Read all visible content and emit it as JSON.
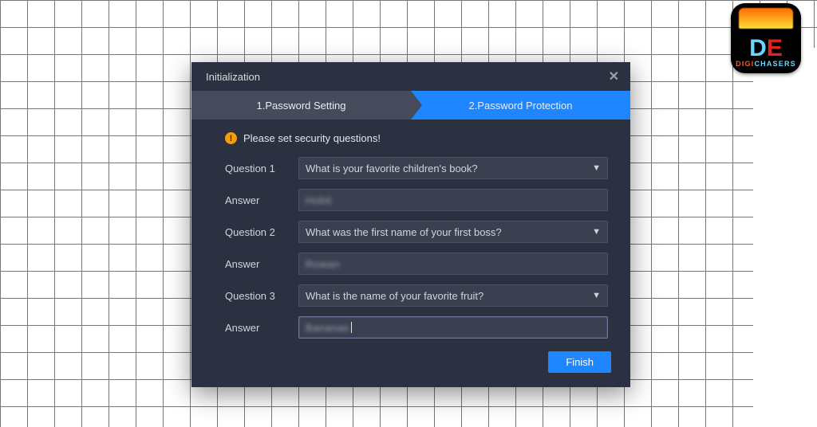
{
  "logo": {
    "brand_top": "DE",
    "brand_bottom_a": "DIGI",
    "brand_bottom_b": "CHASERS"
  },
  "dialog": {
    "title": "Initialization",
    "steps": {
      "one": "1.Password Setting",
      "two": "2.Password Protection"
    },
    "alert": {
      "icon": "!",
      "text": "Please set security questions!"
    },
    "rows": [
      {
        "label": "Question 1",
        "select": "What is your favorite children's book?"
      },
      {
        "label": "Answer",
        "value": "Hobit"
      },
      {
        "label": "Question 2",
        "select": "What was the first name of your first boss?"
      },
      {
        "label": "Answer",
        "value": "Rowan"
      },
      {
        "label": "Question 3",
        "select": "What is the name of your favorite fruit?"
      },
      {
        "label": "Answer",
        "value": "Bananas",
        "focused": true
      }
    ],
    "finish": "Finish"
  }
}
